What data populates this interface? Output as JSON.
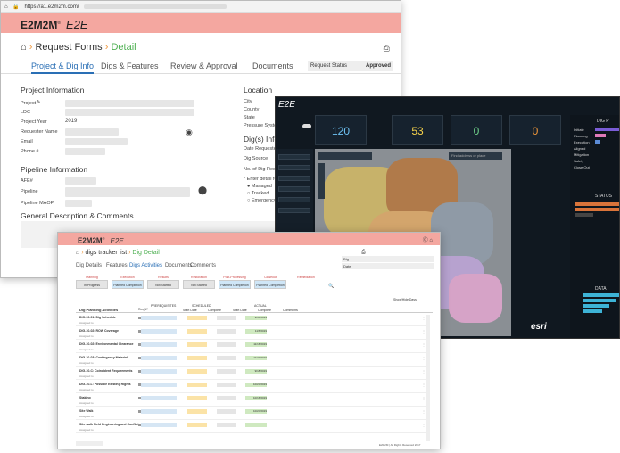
{
  "w1": {
    "url": "https://a1.e2m2m.com/",
    "brand_a": "E2M2M",
    "brand_sup": "®",
    "brand_b": "E2E",
    "crumb_home": "⌂",
    "crumb_a": "Request Forms",
    "crumb_sep": "›",
    "crumb_b": "Detail",
    "printer": "⎙",
    "tabs": [
      "Project & Dig Info",
      "Digs & Features",
      "Review & Approval",
      "Documents"
    ],
    "request_status_label": "Request Status",
    "request_status_value": "Approved",
    "project_info_title": "Project Information",
    "fields": [
      "Project",
      "LDC",
      "Project Year",
      "Requester Name",
      "Email",
      "Phone #"
    ],
    "project_year": "2019",
    "location_title": "Location",
    "location_fields": [
      "City",
      "County",
      "State",
      "Pressure System"
    ],
    "dig_info_title": "Dig(s) Info",
    "dig_fields": [
      "Date Requested",
      "Dig Source",
      "No. of Dig Requests",
      "* Enter detail for"
    ],
    "radio_options": [
      "Managed",
      "Tracked",
      "Emergency"
    ],
    "pipeline_title": "Pipeline Information",
    "pipeline_fields": [
      "AFE#",
      "Pipeline",
      "Pipeline MAOP"
    ],
    "general_title": "General Description & Comments"
  },
  "w2": {
    "logo": "E2E",
    "kpis": [
      {
        "value": "120",
        "color": "#6ec3f4"
      },
      {
        "value": "53",
        "color": "#f5d14a"
      },
      {
        "value": "0",
        "color": "#6fd18a"
      },
      {
        "value": "0",
        "color": "#f0973a"
      }
    ],
    "search_placeholder": "Find address or place",
    "esri": "esri",
    "panel_title": "DIG P",
    "right_labels": [
      "Initiate",
      "Planning",
      "Execution",
      "Aligned",
      "Mitigation",
      "Safety",
      "Close Out"
    ],
    "status_title": "STATUS",
    "data_title": "DATA"
  },
  "w3": {
    "brand_a": "E2M2M",
    "brand_sup": "®",
    "brand_b": "E2E",
    "icons": "⓪ ⌂",
    "crumb_a": "digs tracker list",
    "crumb_sep": "›",
    "crumb_b": "Dig Detail",
    "printer": "⎙",
    "info_labels": [
      "Dig",
      "Date"
    ],
    "tabs": [
      "Dig Details",
      "Features",
      "Digs Activities",
      "Documents",
      "Comments"
    ],
    "phases": [
      {
        "title": "Planning",
        "box": "In Progress"
      },
      {
        "title": "Execution",
        "box": "Planned Completion"
      },
      {
        "title": "Results",
        "box": "Not Started"
      },
      {
        "title": "Restoration",
        "box": "Not Started"
      },
      {
        "title": "Post-Processing",
        "box": "Planned Completion"
      },
      {
        "title": "Closeout",
        "box": "Planned Completion"
      },
      {
        "title": "Remediation",
        "box": ""
      }
    ],
    "show_hide": "Show/Hide Days",
    "table_title": "Dig Planning Activities",
    "col_required": "Req'd?",
    "col_prereq": "PREREQUISITES",
    "col_scheduled": "SCHEDULED",
    "col_start": "Start Date",
    "col_complete": "Complete",
    "col_actual": "ACTUAL",
    "col_comments": "Comments",
    "rows": [
      {
        "title": "DIG-10-01: Dig Schedule",
        "date": "9/18/2019"
      },
      {
        "title": "DIG-10-02: ROW Coverage",
        "date": "11/6/2019"
      },
      {
        "title": "DIG-10-02: Environmental Clearance",
        "date": "11/18/2019"
      },
      {
        "title": "DIG-10-03: Contingency Material",
        "date": "11/20/2019"
      },
      {
        "title": "DIG-10-C: Coincident Requirements",
        "date": "9/18/2019"
      },
      {
        "title": "DIG-10-L: Possible Existing Rights",
        "date": "10/23/2019"
      },
      {
        "title": "Staking",
        "date": "10/18/2019"
      },
      {
        "title": "Site Walk",
        "date": "10/24/2019"
      },
      {
        "title": "Site walk Field Engineering and Conflict",
        "date": ""
      }
    ],
    "row_sub": "Assigned to",
    "footer": "E2M2M | All Rights Reserved 2017"
  }
}
